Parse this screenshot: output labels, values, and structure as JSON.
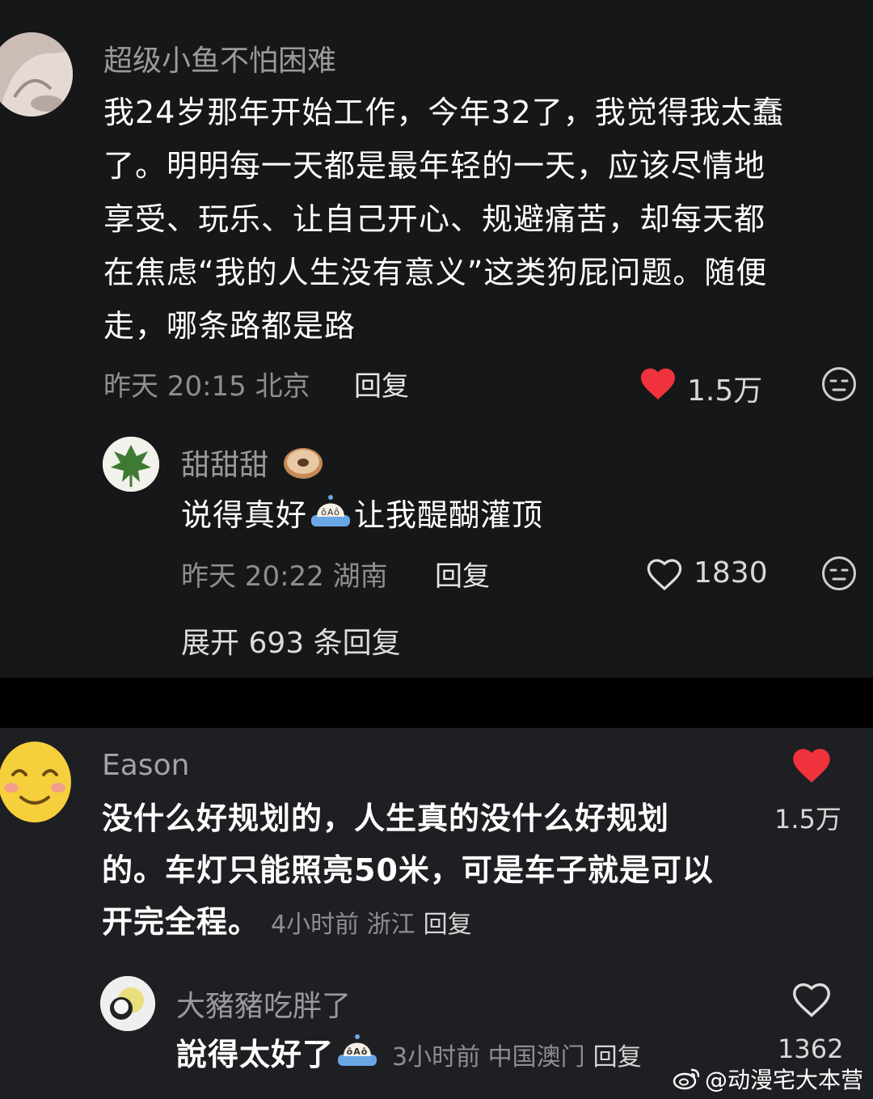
{
  "comment1": {
    "username": "超级小鱼不怕困难",
    "lines": [
      "我24岁那年开始工作，今年32了，我觉得我太蠢",
      "了。明明每一天都是最年轻的一天，应该尽情地",
      "享受、玩乐、让自己开心、规避痛苦，却每天都",
      "在焦虑“我的人生没有意义”这类狗屁问题。随便",
      "走，哪条路都是路"
    ],
    "meta": "昨天 20:15 北京",
    "reply_label": "回复",
    "likes": "1.5万",
    "liked": true
  },
  "reply1": {
    "username": "甜甜甜",
    "text": "说得真好",
    "text_suffix": "让我醍醐灌顶",
    "meta": "昨天 20:22 湖南",
    "reply_label": "回复",
    "likes": "1830",
    "liked": false
  },
  "expand_label": "展开 693 条回复",
  "comment2": {
    "username": "Eason",
    "lines": [
      "没什么好规划的，人生真的没什么好规划",
      "的。车灯只能照亮50米，可是车子就是可以",
      "开完全程。"
    ],
    "meta": "4小时前 浙江",
    "reply_label": "回复",
    "likes": "1.5万",
    "liked": true
  },
  "reply2": {
    "username": "大豬豬吃胖了",
    "text": "說得太好了",
    "meta": "3小时前 中国澳门",
    "reply_label": "回复",
    "likes": "1362",
    "liked": false
  },
  "watermark": "@动漫宅大本营",
  "colors": {
    "like_red": "#f0323c",
    "panel_dark": "#161718",
    "panel_mid": "#1e1f22"
  }
}
